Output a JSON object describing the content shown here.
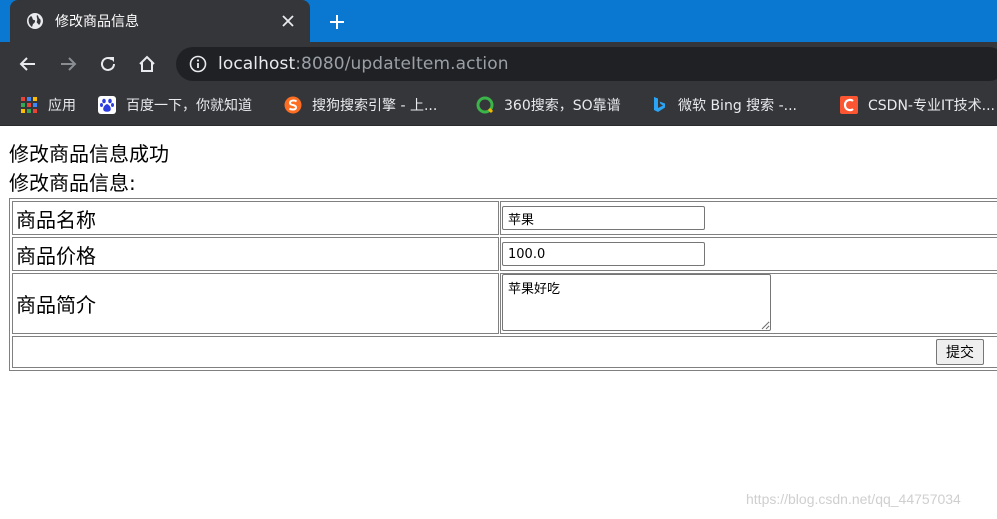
{
  "browser": {
    "tab": {
      "title": "修改商品信息",
      "close_icon": "close-icon"
    },
    "new_tab_icon": "plus-icon",
    "nav": {
      "back_icon": "back-arrow-icon",
      "forward_icon": "forward-arrow-icon",
      "reload_icon": "reload-icon",
      "home_icon": "home-icon"
    },
    "address": {
      "host": "localhost",
      "rest": ":8080/updateItem.action"
    },
    "bookmarks": [
      {
        "label": "应用",
        "icon": "apps-grid-icon"
      },
      {
        "label": "百度一下，你就知道",
        "icon": "baidu-paw-icon"
      },
      {
        "label": "搜狗搜索引擎 - 上...",
        "icon": "sogou-icon"
      },
      {
        "label": "360搜索，SO靠谱",
        "icon": "360-search-icon"
      },
      {
        "label": "微软 Bing 搜索 -...",
        "icon": "bing-icon"
      },
      {
        "label": "CSDN-专业IT技术...",
        "icon": "csdn-icon"
      }
    ],
    "colors": {
      "tabstrip": "#0a78d1",
      "chrome": "#35363a",
      "omnibox": "#202124"
    }
  },
  "page": {
    "success_message": "修改商品信息成功",
    "form_heading": "修改商品信息:",
    "form": {
      "name_label": "商品名称",
      "name_value": "苹果",
      "price_label": "商品价格",
      "price_value": "100.0",
      "desc_label": "商品简介",
      "desc_value": "苹果好吃",
      "submit_label": "提交"
    },
    "watermark": "https://blog.csdn.net/qq_44757034"
  }
}
